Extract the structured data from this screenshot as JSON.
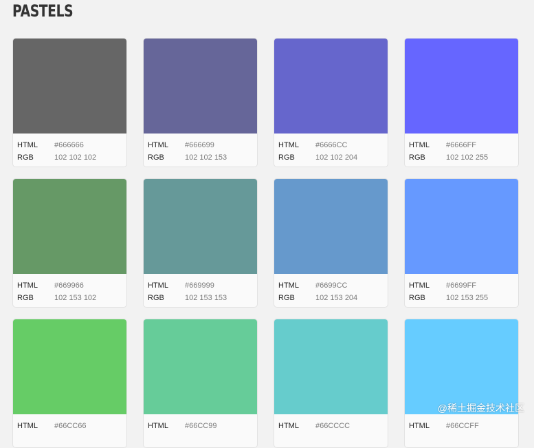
{
  "page_title": "PASTELS",
  "labels": {
    "html": "HTML",
    "rgb": "RGB"
  },
  "watermark": "@稀土掘金技术社区",
  "colors": [
    {
      "hex": "#666666",
      "rgb": "102 102 102"
    },
    {
      "hex": "#666699",
      "rgb": "102 102 153"
    },
    {
      "hex": "#6666CC",
      "rgb": "102 102 204"
    },
    {
      "hex": "#6666FF",
      "rgb": "102 102 255"
    },
    {
      "hex": "#669966",
      "rgb": "102 153 102"
    },
    {
      "hex": "#669999",
      "rgb": "102 153 153"
    },
    {
      "hex": "#6699CC",
      "rgb": "102 153 204"
    },
    {
      "hex": "#6699FF",
      "rgb": "102 153 255"
    },
    {
      "hex": "#66CC66",
      "rgb": ""
    },
    {
      "hex": "#66CC99",
      "rgb": ""
    },
    {
      "hex": "#66CCCC",
      "rgb": ""
    },
    {
      "hex": "#66CCFF",
      "rgb": ""
    }
  ]
}
